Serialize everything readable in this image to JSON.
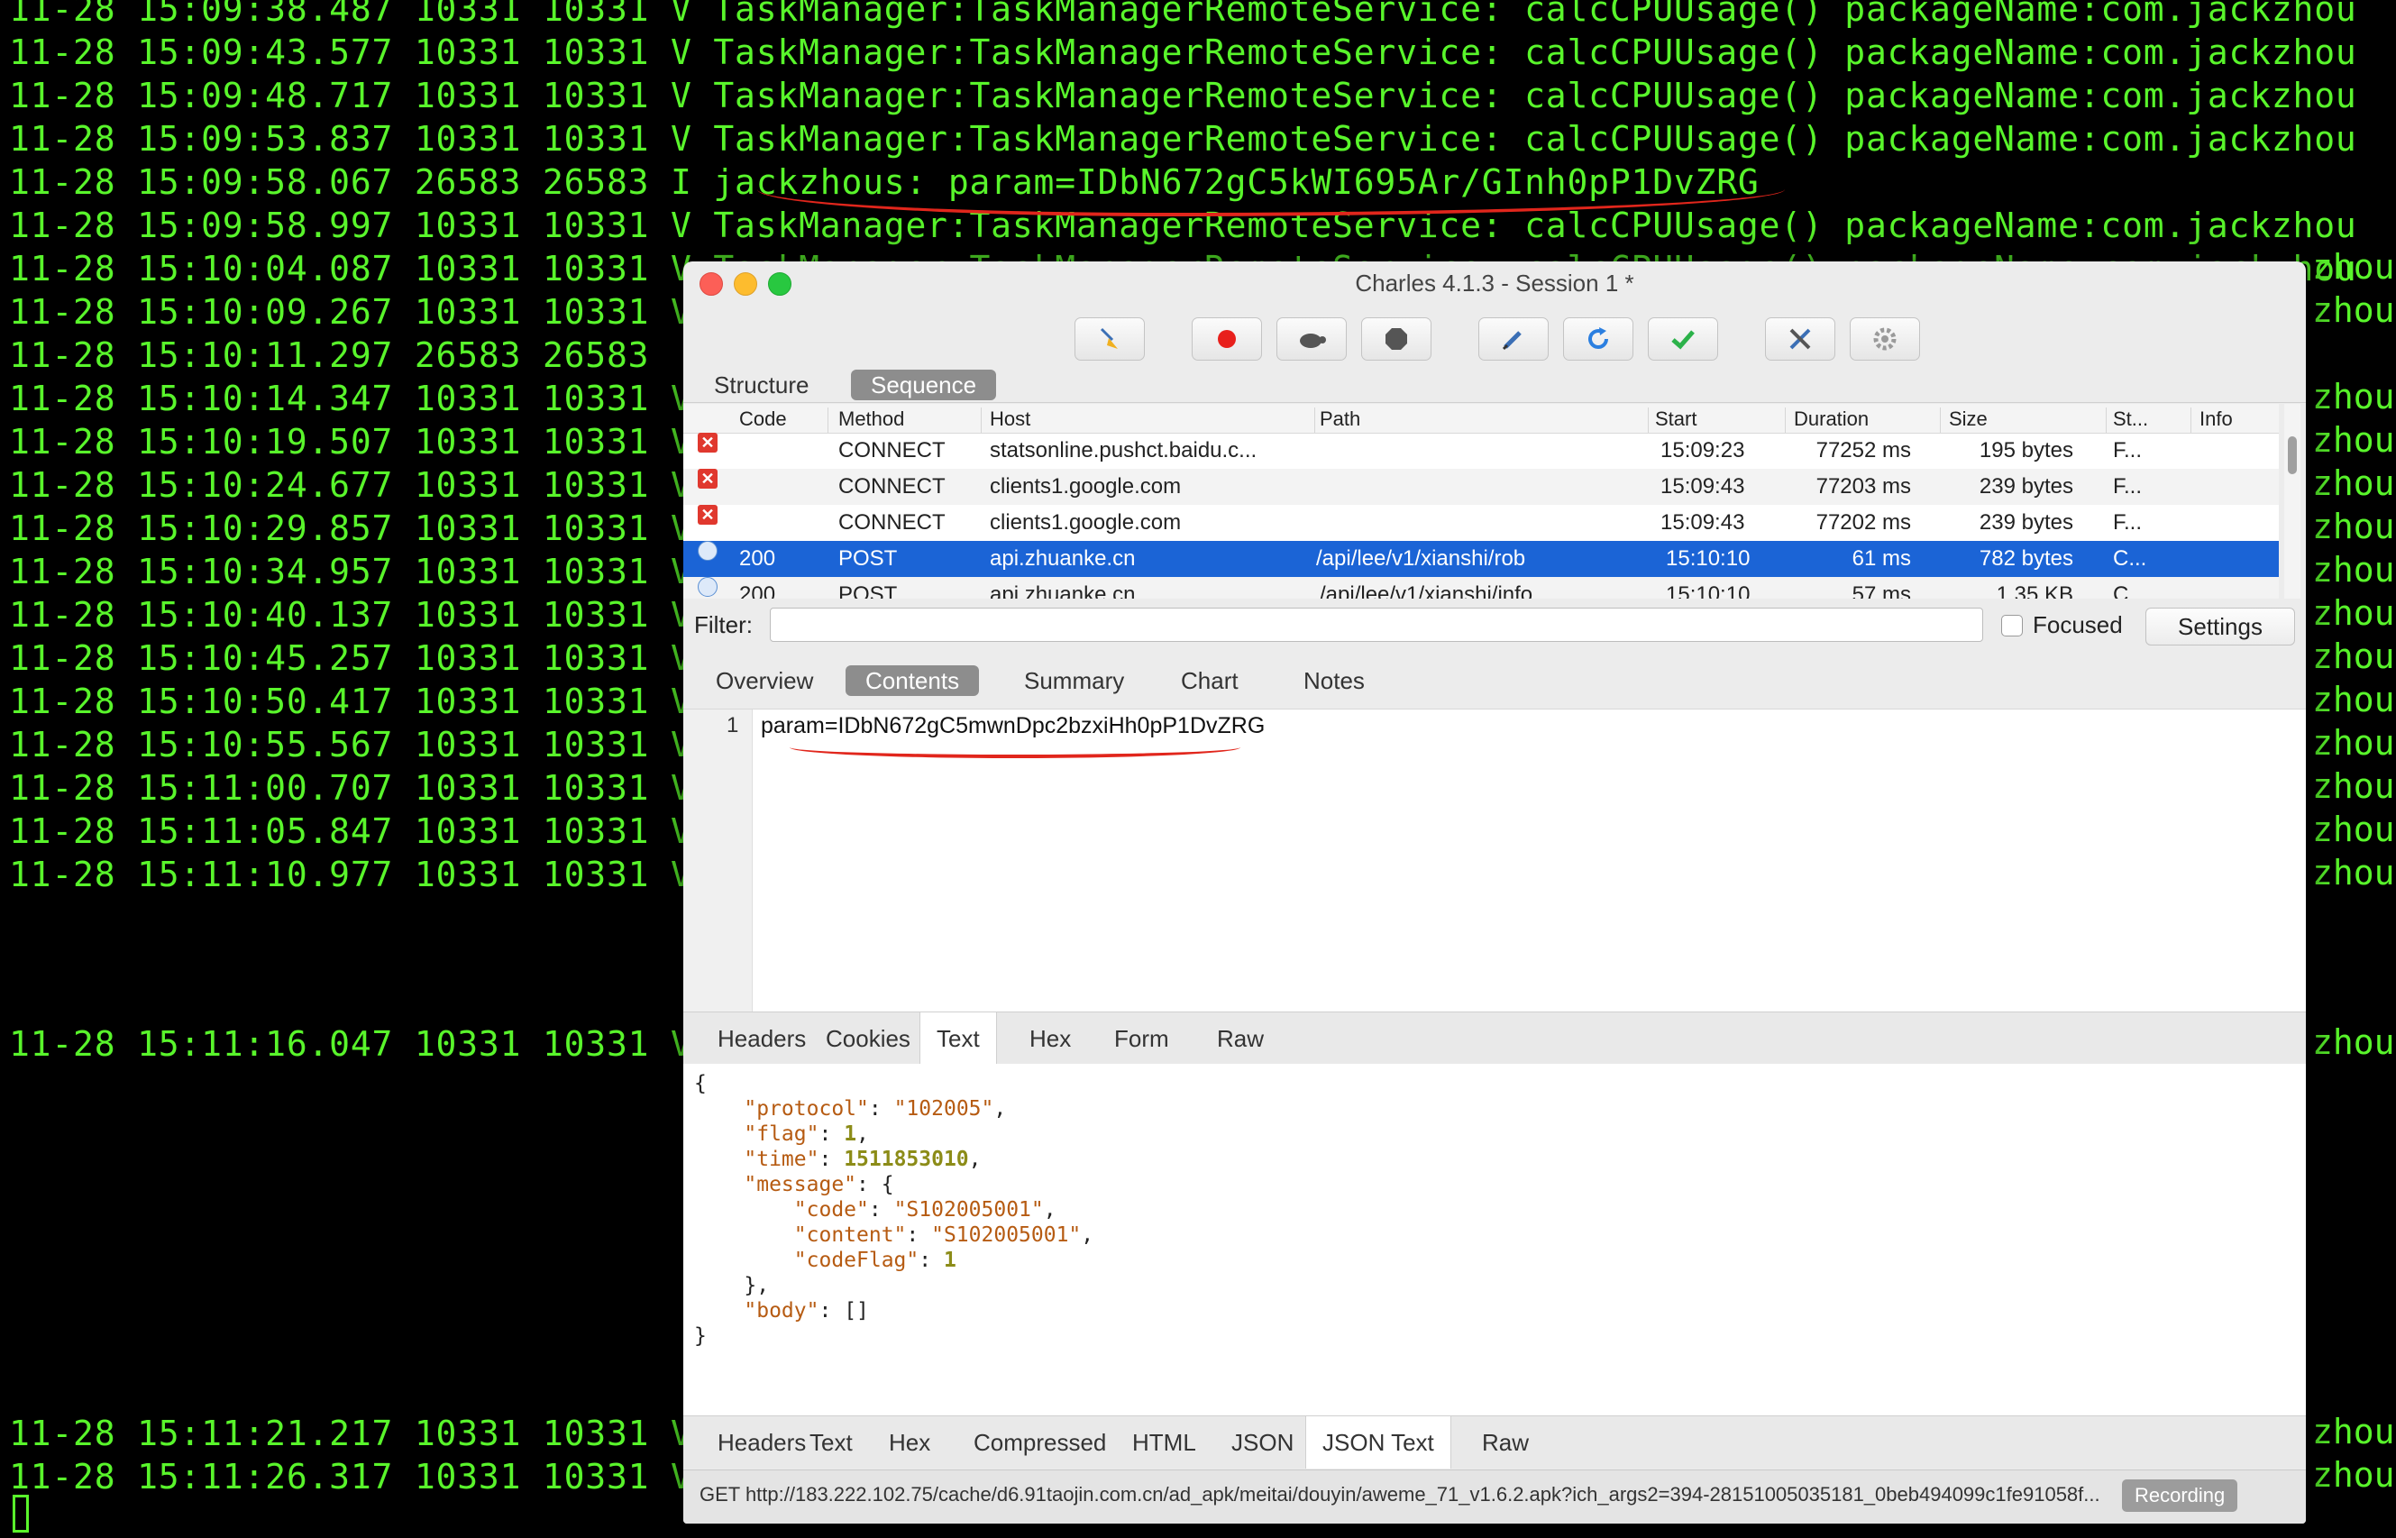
{
  "terminal": {
    "lines": [
      "11-28 15:09:38.487 10331 10331 V TaskManager:TaskManagerRemoteService: calcCPUUsage() packageName:com.jackzhou",
      "11-28 15:09:43.577 10331 10331 V TaskManager:TaskManagerRemoteService: calcCPUUsage() packageName:com.jackzhou",
      "11-28 15:09:48.717 10331 10331 V TaskManager:TaskManagerRemoteService: calcCPUUsage() packageName:com.jackzhou",
      "11-28 15:09:53.837 10331 10331 V TaskManager:TaskManagerRemoteService: calcCPUUsage() packageName:com.jackzhou",
      "11-28 15:09:58.067 26583 26583 I jackzhous: param=IDbN672gC5kWI695Ar/GInh0pP1DvZRG",
      "11-28 15:09:58.997 10331 10331 V TaskManager:TaskManagerRemoteService: calcCPUUsage() packageName:com.jackzhou",
      "11-28 15:10:04.087 10331 10331 V TaskManager:TaskManagerRemoteService: calcCPUUsage() packageName:com.jackzhou",
      "11-28 15:10:09.267 10331 10331 V",
      "11-28 15:10:11.297 26583 26583",
      "11-28 15:10:14.347 10331 10331 V",
      "11-28 15:10:19.507 10331 10331 V",
      "11-28 15:10:24.677 10331 10331 V",
      "11-28 15:10:29.857 10331 10331 V",
      "11-28 15:10:34.957 10331 10331 V",
      "11-28 15:10:40.137 10331 10331 V",
      "11-28 15:10:45.257 10331 10331 V",
      "11-28 15:10:50.417 10331 10331 V",
      "11-28 15:10:55.567 10331 10331 V",
      "11-28 15:11:00.707 10331 10331 V",
      "11-28 15:11:05.847 10331 10331 V",
      "11-28 15:11:10.977 10331 10331 V"
    ],
    "late_lines": [
      "11-28 15:11:16.047 10331 10331 V",
      "11-28 15:11:21.217 10331 10331 V",
      "11-28 15:11:26.317 10331 10331 V"
    ],
    "right_edge_text": "zhou"
  },
  "charles": {
    "title": "Charles 4.1.3 - Session 1 *",
    "view_tabs": [
      "Structure",
      "Sequence"
    ],
    "active_view_tab": "Sequence",
    "columns": [
      "Code",
      "Method",
      "Host",
      "Path",
      "Start",
      "Duration",
      "Size",
      "St...",
      "Info"
    ],
    "rows": [
      {
        "status": "error",
        "code": "",
        "method": "CONNECT",
        "host": "statsonline.pushct.baidu.c...",
        "path": "",
        "start": "15:09:23",
        "duration": "77252 ms",
        "size": "195 bytes",
        "st": "F..."
      },
      {
        "status": "error",
        "code": "",
        "method": "CONNECT",
        "host": "clients1.google.com",
        "path": "",
        "start": "15:09:43",
        "duration": "77203 ms",
        "size": "239 bytes",
        "st": "F..."
      },
      {
        "status": "error",
        "code": "",
        "method": "CONNECT",
        "host": "clients1.google.com",
        "path": "",
        "start": "15:09:43",
        "duration": "77202 ms",
        "size": "239 bytes",
        "st": "F..."
      },
      {
        "status": "ok",
        "code": "200",
        "method": "POST",
        "host": "api.zhuanke.cn",
        "path": "/api/lee/v1/xianshi/rob",
        "start": "15:10:10",
        "duration": "61 ms",
        "size": "782 bytes",
        "st": "C..."
      },
      {
        "status": "ok",
        "code": "200",
        "method": "POST",
        "host": "api.zhuanke.cn",
        "path": "/api/lee/v1/xianshi/info",
        "start": "15:10:10",
        "duration": "57 ms",
        "size": "1.35 KB",
        "st": "C..."
      }
    ],
    "selected_row": 3,
    "filter_label": "Filter:",
    "filter_value": "",
    "focused_label": "Focused",
    "settings_label": "Settings",
    "detail_tabs": [
      "Overview",
      "Contents",
      "Summary",
      "Chart",
      "Notes"
    ],
    "active_detail_tab": "Contents",
    "request_line_number": "1",
    "request_text": "param=IDbN672gC5mwnDpc2bzxiHh0pP1DvZRG",
    "request_tabs": [
      "Headers",
      "Cookies",
      "Text",
      "Hex",
      "Form",
      "Raw"
    ],
    "active_request_tab": "Text",
    "response_json": {
      "open": "{",
      "protocol_key": "\"protocol\"",
      "protocol_val": "\"102005\"",
      "flag_key": "\"flag\"",
      "flag_val": "1",
      "time_key": "\"time\"",
      "time_val": "1511853010",
      "message_key": "\"message\"",
      "code_key": "\"code\"",
      "code_val": "\"S102005001\"",
      "content_key": "\"content\"",
      "content_val": "\"S102005001\"",
      "codeflag_key": "\"codeFlag\"",
      "codeflag_val": "1",
      "body_key": "\"body\"",
      "body_val": "[]",
      "close": "}"
    },
    "response_tabs": [
      "Headers",
      "Text",
      "Hex",
      "Compressed",
      "HTML",
      "JSON",
      "JSON Text",
      "Raw"
    ],
    "active_response_tab": "JSON Text",
    "status_text": "GET http://183.222.102.75/cache/d6.91taojin.com.cn/ad_apk/meitai/douyin/aweme_71_v1.6.2.apk?ich_args2=394-28151005035181_0beb494099c1fe91058f...",
    "recording_label": "Recording"
  }
}
